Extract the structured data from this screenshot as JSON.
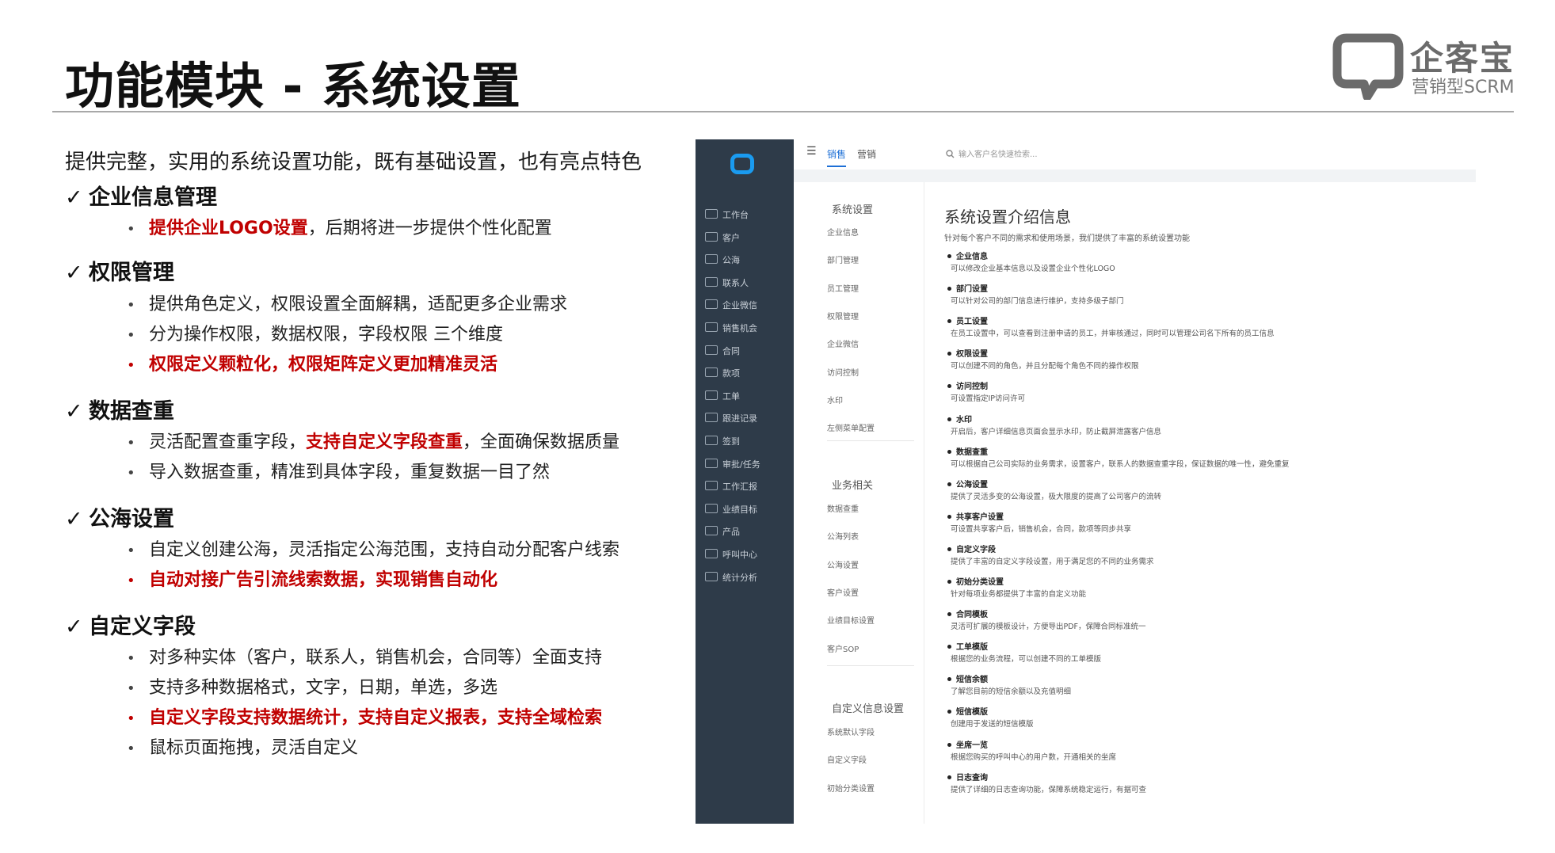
{
  "header": {
    "title": "功能模块 - 系统设置",
    "logo_cn": "企客宝",
    "logo_en": "营销型SCRM",
    "brand_color": "#6b6b6b"
  },
  "intro": "提供完整，实用的系统设置功能，既有基础设置，也有亮点特色",
  "check_icon": "✓",
  "sections": [
    {
      "title": "企业信息管理",
      "bullets": [
        {
          "parts": [
            {
              "text": "提供企业LOGO设置",
              "hl": true
            },
            {
              "text": "，后期将进一步提供个性化配置",
              "hl": false
            }
          ]
        }
      ]
    },
    {
      "title": "权限管理",
      "bullets": [
        {
          "parts": [
            {
              "text": "提供角色定义，权限设置全面解耦，适配更多企业需求",
              "hl": false
            }
          ]
        },
        {
          "parts": [
            {
              "text": "分为操作权限，数据权限，字段权限 三个维度",
              "hl": false
            }
          ]
        },
        {
          "parts": [
            {
              "text": "权限定义颗粒化，权限矩阵定义更加精准灵活",
              "hl": true
            }
          ]
        }
      ]
    },
    {
      "title": "数据查重",
      "bullets": [
        {
          "parts": [
            {
              "text": "灵活配置查重字段，",
              "hl": false
            },
            {
              "text": "支持自定义字段查重",
              "hl": true
            },
            {
              "text": "，全面确保数据质量",
              "hl": false
            }
          ]
        },
        {
          "parts": [
            {
              "text": "导入数据查重，精准到具体字段，重复数据一目了然",
              "hl": false
            }
          ]
        }
      ]
    },
    {
      "title": "公海设置",
      "bullets": [
        {
          "parts": [
            {
              "text": "自定义创建公海，灵活指定公海范围，支持自动分配客户线索",
              "hl": false
            }
          ]
        },
        {
          "parts": [
            {
              "text": "自动对接广告引流线索数据，实现销售自动化",
              "hl": true
            }
          ]
        }
      ]
    },
    {
      "title": "自定义字段",
      "bullets": [
        {
          "parts": [
            {
              "text": "对多种实体（客户，联系人，销售机会，合同等）全面支持",
              "hl": false
            }
          ]
        },
        {
          "parts": [
            {
              "text": "支持多种数据格式，文字，日期，单选，多选",
              "hl": false
            }
          ]
        },
        {
          "parts": [
            {
              "text": "自定义字段支持数据统计，支持自定义报表，支持全域检索",
              "hl": true
            }
          ]
        },
        {
          "parts": [
            {
              "text": "鼠标页面拖拽，灵活自定义",
              "hl": false
            }
          ]
        }
      ]
    }
  ],
  "app": {
    "accent": "#1d6fd6",
    "sidebar_color": "#2e3b49",
    "sidebar": [
      "工作台",
      "客户",
      "公海",
      "联系人",
      "企业微信",
      "销售机会",
      "合同",
      "款项",
      "工单",
      "跟进记录",
      "签到",
      "审批/任务",
      "工作汇报",
      "业绩目标",
      "产品",
      "呼叫中心",
      "统计分析"
    ],
    "tabs": [
      "销售",
      "营销"
    ],
    "menu_icon": "☰",
    "search_placeholder": "输入客户名快速检索...",
    "settings_groups": [
      {
        "title": "系统设置",
        "items": [
          "企业信息",
          "部门管理",
          "员工管理",
          "权限管理",
          "企业微信",
          "访问控制",
          "水印",
          "左侧菜单配置"
        ]
      },
      {
        "title": "业务相关",
        "items": [
          "数据查重",
          "公海列表",
          "公海设置",
          "客户设置",
          "业绩目标设置",
          "客户SOP"
        ]
      },
      {
        "title": "自定义信息设置",
        "items": [
          "系统默认字段",
          "自定义字段",
          "初始分类设置"
        ]
      }
    ],
    "detail_title": "系统设置介绍信息",
    "detail_subtitle": "针对每个客户不同的需求和使用场景，我们提供了丰富的系统设置功能",
    "detail_items": [
      {
        "title": "企业信息",
        "desc": "可以修改企业基本信息以及设置企业个性化LOGO"
      },
      {
        "title": "部门设置",
        "desc": "可以针对公司的部门信息进行维护，支持多级子部门"
      },
      {
        "title": "员工设置",
        "desc": "在员工设置中，可以查看到注册申请的员工，并审核通过，同时可以管理公司名下所有的员工信息"
      },
      {
        "title": "权限设置",
        "desc": "可以创建不同的角色，并且分配每个角色不同的操作权限"
      },
      {
        "title": "访问控制",
        "desc": "可设置指定IP访问许可"
      },
      {
        "title": "水印",
        "desc": "开启后，客户详细信息页面会显示水印，防止截屏泄露客户信息"
      },
      {
        "title": "数据查重",
        "desc": "可以根据自己公司实际的业务需求，设置客户，联系人的数据查重字段，保证数据的唯一性，避免重复"
      },
      {
        "title": "公海设置",
        "desc": "提供了灵活多变的公海设置，极大限度的提高了公司客户的流转"
      },
      {
        "title": "共享客户设置",
        "desc": "可设置共享客户后，销售机会，合同，款项等同步共享"
      },
      {
        "title": "自定义字段",
        "desc": "提供了丰富的自定义字段设置，用于满足您的不同的业务需求"
      },
      {
        "title": "初始分类设置",
        "desc": "针对每项业务都提供了丰富的自定义功能"
      },
      {
        "title": "合同模板",
        "desc": "灵活可扩展的模板设计，方便导出PDF，保障合同标准统一"
      },
      {
        "title": "工单模版",
        "desc": "根据您的业务流程，可以创建不同的工单模版"
      },
      {
        "title": "短信余额",
        "desc": "了解您目前的短信余额以及充值明细"
      },
      {
        "title": "短信模版",
        "desc": "创建用于发送的短信模版"
      },
      {
        "title": "坐席一览",
        "desc": "根据您购买的呼叫中心的用户数，开通相关的坐席"
      },
      {
        "title": "日志查询",
        "desc": "提供了详细的日志查询功能，保障系统稳定运行，有据可查"
      }
    ]
  }
}
